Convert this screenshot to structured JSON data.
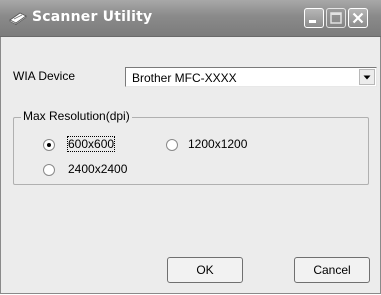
{
  "window": {
    "title": "Scanner Utility"
  },
  "wia": {
    "label": "WIA Device",
    "selected": "Brother MFC-XXXX"
  },
  "resolution": {
    "group_label": "Max Resolution(dpi)",
    "options": [
      "600x600",
      "1200x1200",
      "2400x2400"
    ],
    "selected": "600x600"
  },
  "buttons": {
    "ok": "OK",
    "cancel": "Cancel"
  },
  "icons": {
    "app": "scanner-icon",
    "minimize": "minimize-icon",
    "maximize": "maximize-icon",
    "close": "close-icon",
    "dropdown": "chevron-down-icon"
  },
  "colors": {
    "titlebar": "#8a8a8a",
    "title_text": "#ffffff",
    "client_bg": "#ececec"
  }
}
